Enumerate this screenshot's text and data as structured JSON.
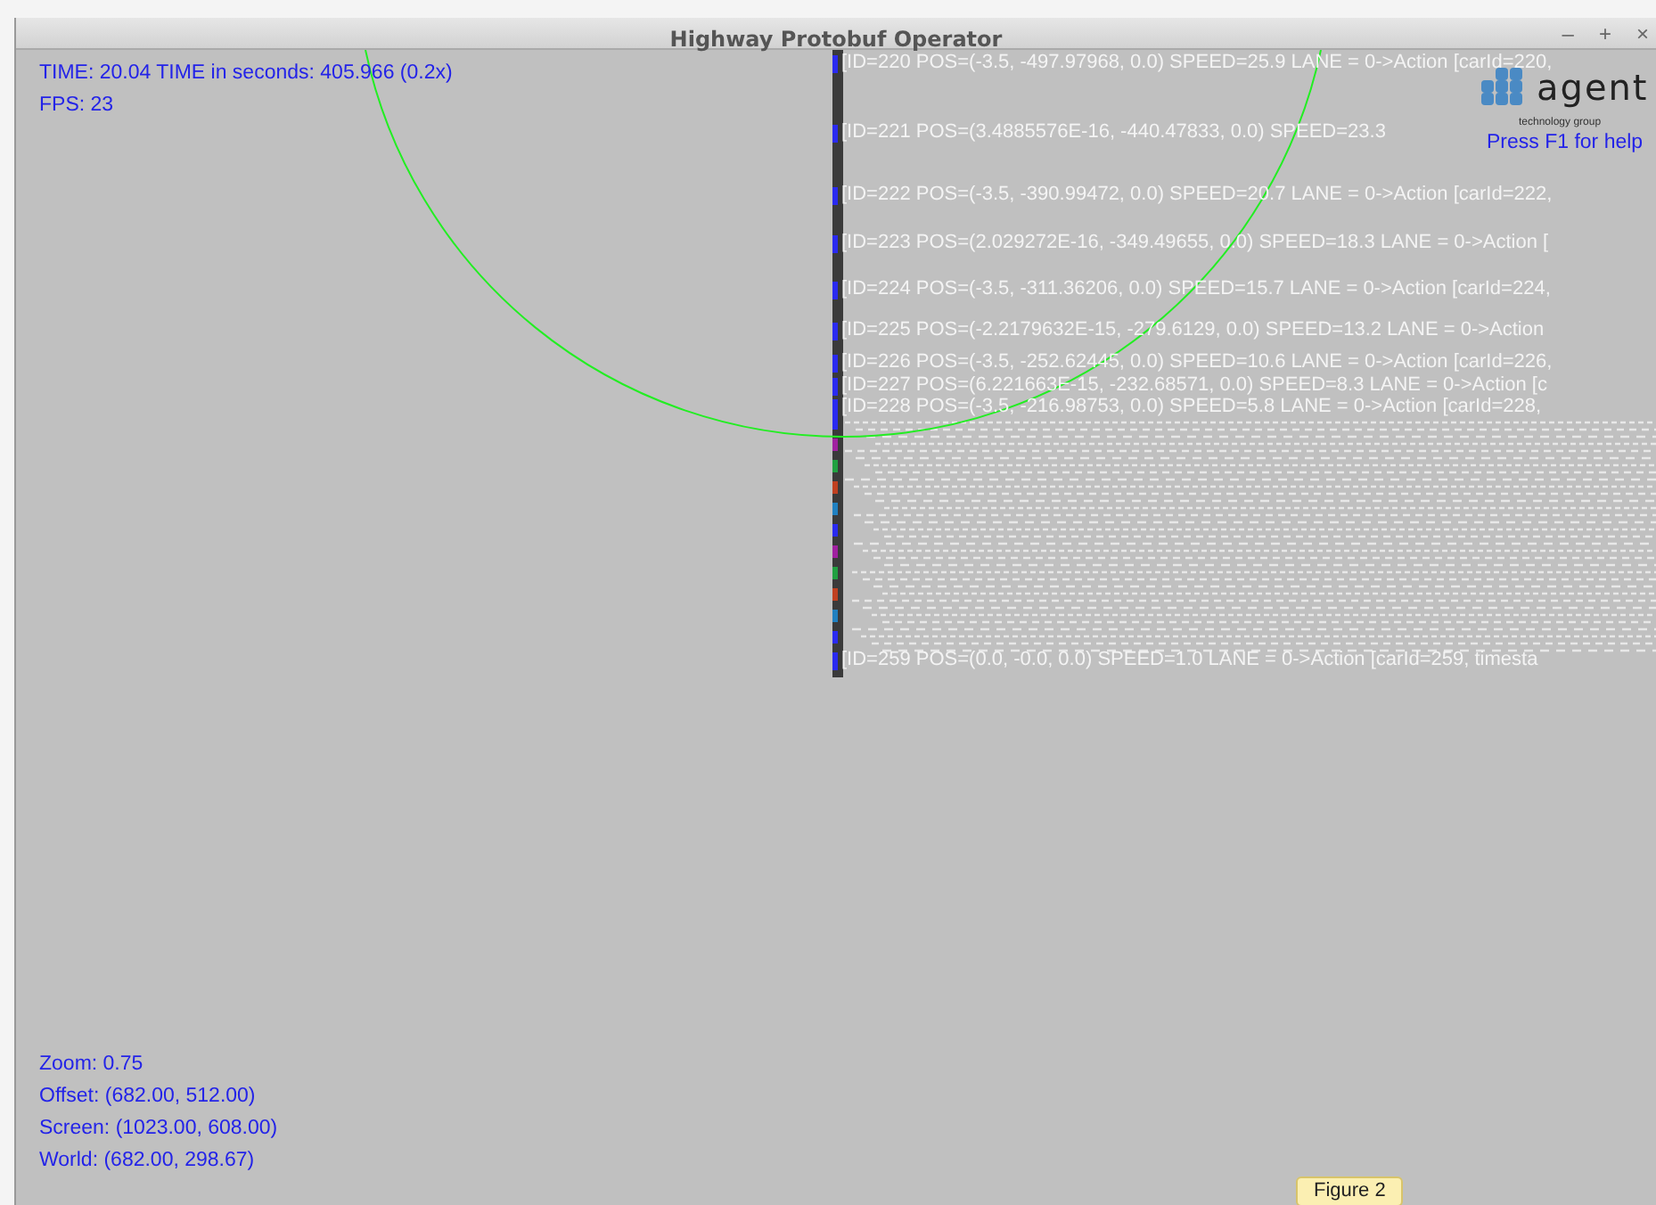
{
  "window": {
    "title": "Highway Protobuf Operator",
    "controls": [
      "–",
      "+",
      "×"
    ]
  },
  "hud_top": [
    "TIME: 20.04 TIME in seconds: 405.966 (0.2x)",
    "FPS: 23"
  ],
  "logo": {
    "name": "agent",
    "tagline": "technology group"
  },
  "help_hint": "Press F1 for help",
  "vehicle_labels": [
    "[ID=220 POS=(-3.5, -497.97968, 0.0) SPEED=25.9 LANE = 0->Action [carId=220,",
    "[ID=221 POS=(3.4885576E-16, -440.47833, 0.0) SPEED=23.3",
    "[ID=222 POS=(-3.5, -390.99472, 0.0) SPEED=20.7 LANE = 0->Action [carId=222,",
    "[ID=223 POS=(2.029272E-16, -349.49655, 0.0) SPEED=18.3 LANE = 0->Action [",
    "[ID=224 POS=(-3.5, -311.36206, 0.0) SPEED=15.7 LANE = 0->Action [carId=224,",
    "[ID=225 POS=(-2.2179632E-15, -279.6129, 0.0) SPEED=13.2 LANE = 0->Action",
    "[ID=226 POS=(-3.5, -252.62445, 0.0) SPEED=10.6 LANE = 0->Action [carId=226,",
    "[ID=227 POS=(6.221663E-15, -232.68571, 0.0) SPEED=8.3 LANE = 0->Action [c",
    "[ID=228 POS=(-3.5, -216.98753, 0.0) SPEED=5.8 LANE = 0->Action [carId=228,",
    "[ID=259 POS=(0.0, -0.0, 0.0) SPEED=1.0 LANE = 0->Action [carId=259, timesta"
  ],
  "hud_bottom": [
    "Zoom: 0.75",
    "Offset: (682.00, 512.00)",
    "Screen: (1023.00, 608.00)",
    "World: (682.00, 298.67)"
  ],
  "tooltip": "Figure 2"
}
